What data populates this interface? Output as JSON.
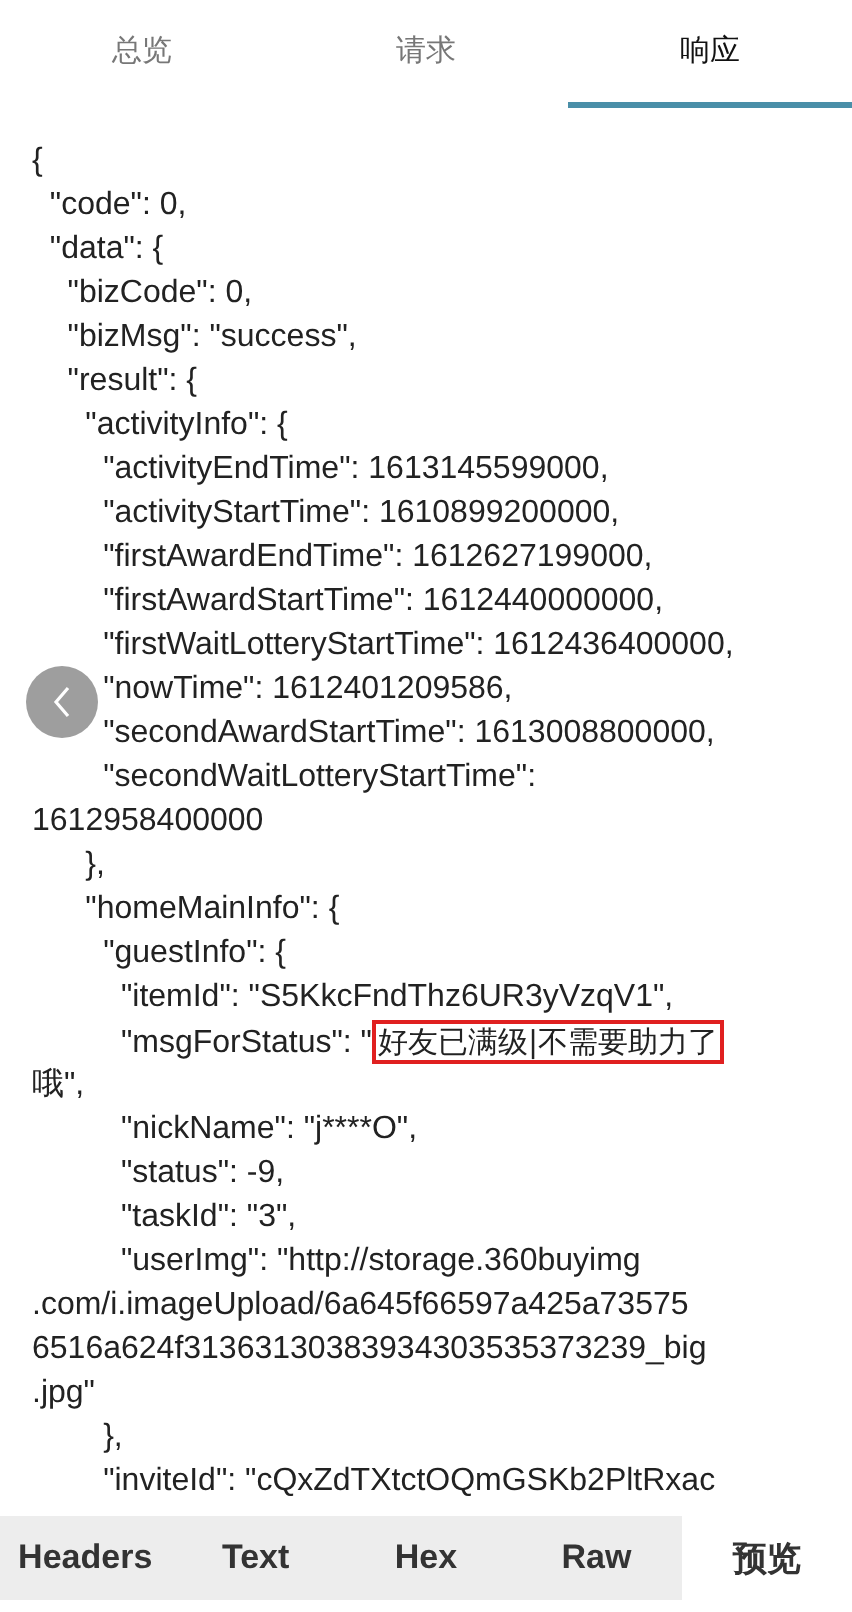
{
  "top_tabs": [
    {
      "label": "总览",
      "selected": false
    },
    {
      "label": "请求",
      "selected": false
    },
    {
      "label": "响应",
      "selected": true
    }
  ],
  "code_lines": [
    {
      "text": "{"
    },
    {
      "text": "  \"code\": 0,"
    },
    {
      "text": "  \"data\": {"
    },
    {
      "text": "    \"bizCode\": 0,"
    },
    {
      "text": "    \"bizMsg\": \"success\","
    },
    {
      "text": "    \"result\": {"
    },
    {
      "text": "      \"activityInfo\": {"
    },
    {
      "text": "        \"activityEndTime\": 1613145599000,"
    },
    {
      "text": "        \"activityStartTime\": 1610899200000,"
    },
    {
      "text": "        \"firstAwardEndTime\": 1612627199000,"
    },
    {
      "text": "        \"firstAwardStartTime\": 1612440000000,"
    },
    {
      "text": "        \"firstWaitLotteryStartTime\": 1612436400000,"
    },
    {
      "text": "        \"nowTime\": 1612401209586,"
    },
    {
      "text": "        \"secondAwardStartTime\": 1613008800000,"
    },
    {
      "text": "        \"secondWaitLotteryStartTime\":"
    },
    {
      "text": "1612958400000"
    },
    {
      "text": "      },"
    },
    {
      "text": "      \"homeMainInfo\": {"
    },
    {
      "text": "        \"guestInfo\": {"
    },
    {
      "text": "          \"itemId\": \"S5KkcFndThz6UR3yVzqV1\","
    },
    {
      "text": "          \"msgForStatus\": \"",
      "highlight": "好友已满级|不需要助力了"
    },
    {
      "text": "哦\","
    },
    {
      "text": "          \"nickName\": \"j****O\","
    },
    {
      "text": "          \"status\": -9,"
    },
    {
      "text": "          \"taskId\": \"3\","
    },
    {
      "text": "          \"userImg\": \"http://storage.360buyimg"
    },
    {
      "text": ".com/i.imageUpload/6a645f66597a425a73575"
    },
    {
      "text": "6516a624f31363130383934303535373239_big"
    },
    {
      "text": ".jpg\""
    },
    {
      "text": "        },"
    },
    {
      "text": "        \"inviteId\": \"cQxZdTXtctOQmGSKb2PltRxac"
    }
  ],
  "bottom_tabs": [
    {
      "label": "Headers",
      "selected": false
    },
    {
      "label": "Text",
      "selected": false
    },
    {
      "label": "Hex",
      "selected": false
    },
    {
      "label": "Raw",
      "selected": false
    },
    {
      "label": "预览",
      "selected": true
    }
  ]
}
